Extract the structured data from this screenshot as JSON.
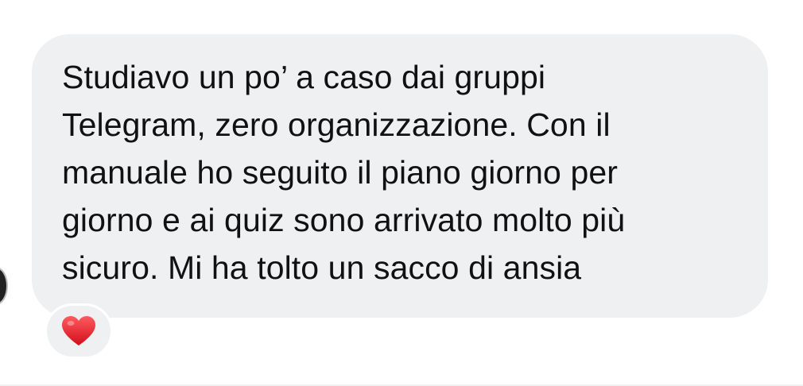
{
  "message": {
    "text": "Studiavo un po’ a caso dai gruppi\nTelegram, zero organizzazione. Con il\nmanuale ho seguito il piano giorno per\ngiorno e ai quiz sono arrivato molto più\nsicuro. Mi ha tolto un sacco di ansia"
  },
  "reaction": {
    "icon": "heart-icon",
    "color": "#e3141f"
  },
  "colors": {
    "bubble": "#eff0f2",
    "text": "#111111"
  }
}
